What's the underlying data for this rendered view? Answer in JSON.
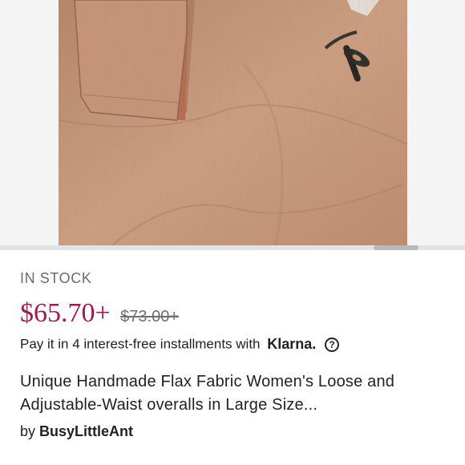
{
  "product": {
    "image_alt": "Tan linen overall fabric with pocket flap and toggle",
    "stock_status": "IN STOCK",
    "price": "$65.70+",
    "original_price": "$73.00+",
    "klarna": {
      "text": "Pay it in 4 interest-free installments with",
      "brand": "Klarna.",
      "help_glyph": "?"
    },
    "title": "Unique Handmade Flax Fabric Women's Loose and Adjustable-Waist overalls in Large Size...",
    "seller": {
      "prefix": "by",
      "name": "BusyLittleAnt"
    }
  },
  "colors": {
    "price": "#9c1c4c",
    "fabric": "#c9987a",
    "background": "#ffffff"
  },
  "icons": {
    "help": "question-circle-icon"
  }
}
